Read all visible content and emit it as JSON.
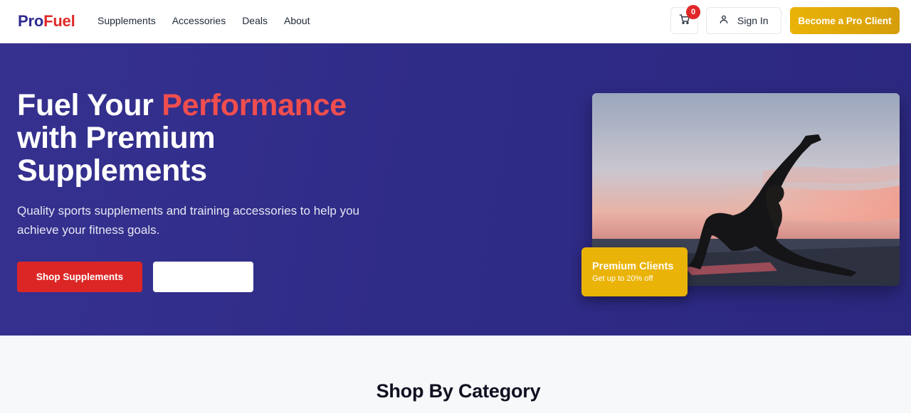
{
  "brand": {
    "part1": "Pro",
    "part2": "Fuel"
  },
  "nav": {
    "links": [
      "Supplements",
      "Accessories",
      "Deals",
      "About"
    ]
  },
  "header": {
    "cart_count": "0",
    "signin_label": "Sign In",
    "cta_label": "Become a Pro Client"
  },
  "hero": {
    "title_part1": "Fuel Your ",
    "title_accent": "Performance",
    "title_line2": "with Premium",
    "title_line3": "Supplements",
    "subtitle": "Quality sports supplements and training accessories to help you achieve your fitness goals.",
    "primary_button": "Shop Supplements",
    "secondary_button": ""
  },
  "promo": {
    "title": "Premium Clients",
    "subtitle": "Get up to 20% off"
  },
  "categories": {
    "title": "Shop By Category"
  },
  "colors": {
    "brand_blue": "#2f2b8f",
    "brand_red": "#e02828",
    "accent_yellow": "#eab308",
    "hero_bg": "#2f2c88"
  }
}
